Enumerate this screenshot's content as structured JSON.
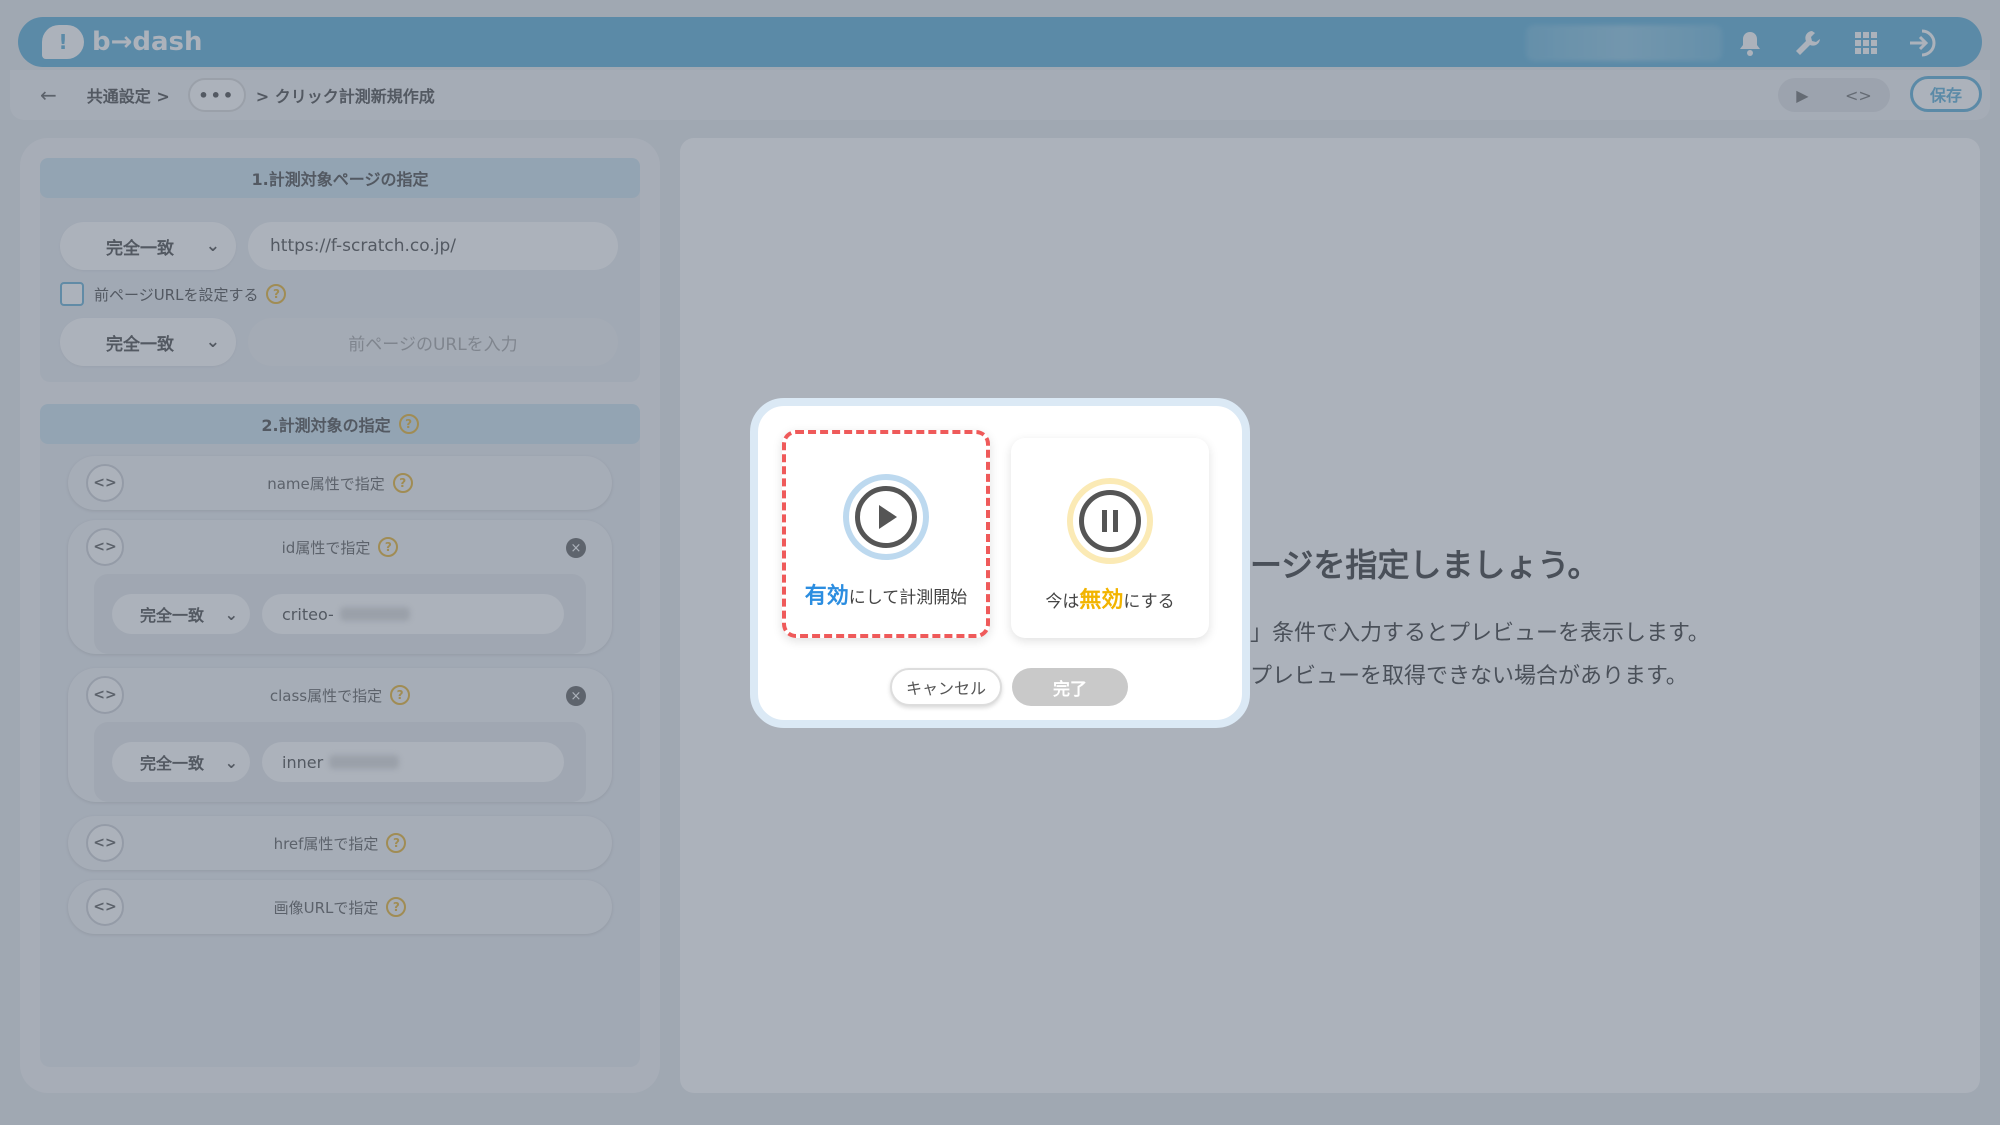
{
  "header": {
    "logo_text": "b→dash",
    "icons": [
      "bell-icon",
      "wrench-icon",
      "grid-icon",
      "logout-icon"
    ]
  },
  "breadcrumb": {
    "items": [
      "共通設定 >",
      "•••",
      "> クリック計測新規作成"
    ]
  },
  "toolbar": {
    "preview_icon": "▶",
    "code_icon": "<>",
    "save_label": "保存"
  },
  "section1": {
    "title": "1.計測対象ページの指定",
    "match_select": "完全一致",
    "url_value": "https://f-scratch.co.jp/",
    "prev_url_checkbox_label": "前ページURLを設定する",
    "prev_match_select": "完全一致",
    "prev_url_placeholder": "前ページのURLを入力"
  },
  "section2": {
    "title": "2.計測対象の指定",
    "attrs": [
      {
        "label": "name属性で指定"
      },
      {
        "label": "id属性で指定",
        "match": "完全一致",
        "value": "criteo-"
      },
      {
        "label": "class属性で指定",
        "match": "完全一致",
        "value": "inner"
      },
      {
        "label": "href属性で指定"
      },
      {
        "label": "画像URLで指定"
      }
    ]
  },
  "preview": {
    "title": "ージを指定しましょう。",
    "line1": "」条件で入力するとプレビューを表示します。",
    "line2": "プレビューを取得できない場合があります。"
  },
  "modal": {
    "start_card": {
      "highlight": "有効",
      "rest": "にして計測開始"
    },
    "stop_card": {
      "prefix": "今は",
      "highlight": "無効",
      "rest": "にする"
    },
    "cancel_label": "キャンセル",
    "done_label": "完了"
  }
}
